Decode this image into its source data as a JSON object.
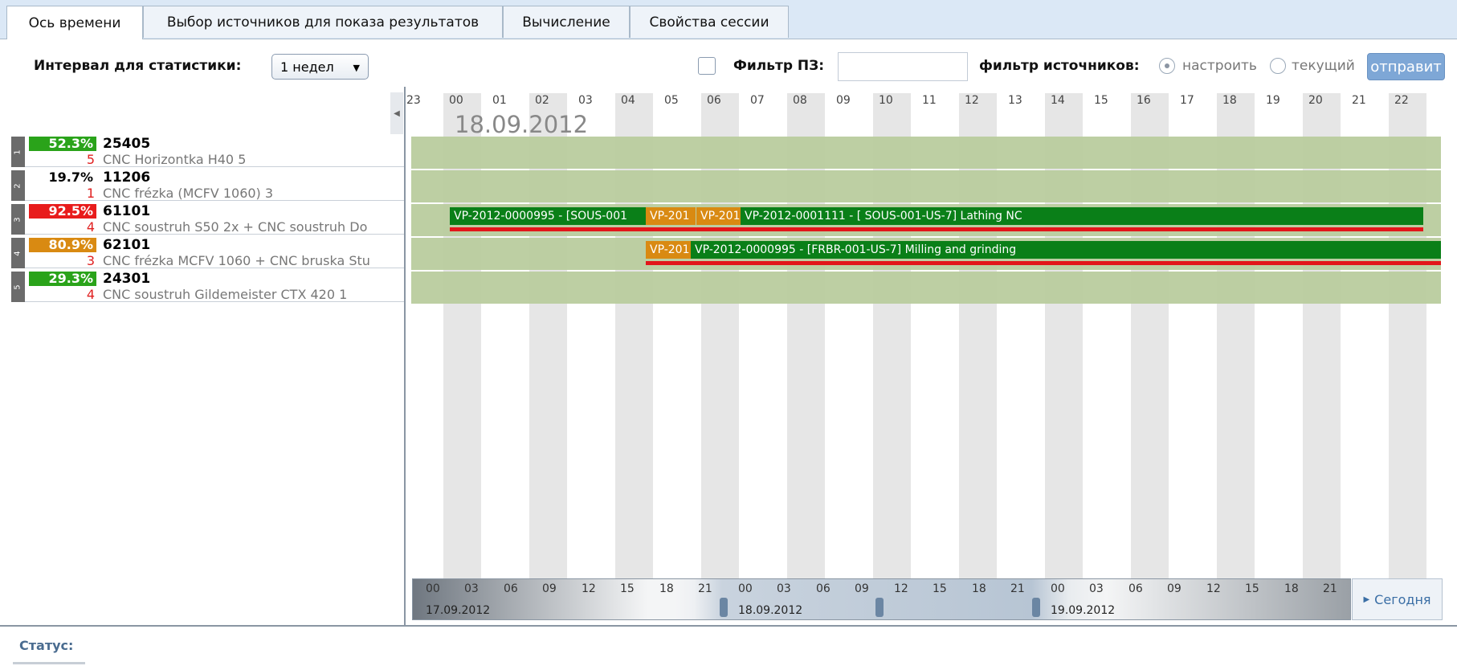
{
  "tabs": [
    {
      "label": "Ось времени",
      "active": true
    },
    {
      "label": "Выбор источников для показа результатов",
      "active": false
    },
    {
      "label": "Вычисление",
      "active": false
    },
    {
      "label": "Свойства сессии",
      "active": false
    }
  ],
  "toolbar": {
    "interval_label": "Интервал для статистики:",
    "interval_value": "1 недел",
    "filter_pz_label": "Фильтр ПЗ:",
    "filter_pz_value": "",
    "source_filter_label": "фильтр источников:",
    "radio_configure": "настроить",
    "radio_current": "текущий",
    "send_button": "отправит"
  },
  "timeline": {
    "date": "18.09.2012",
    "hours": [
      "23",
      "00",
      "01",
      "02",
      "03",
      "04",
      "05",
      "06",
      "07",
      "08",
      "09",
      "10",
      "11",
      "12",
      "13",
      "14",
      "15",
      "16",
      "17",
      "18",
      "19",
      "20",
      "21",
      "22"
    ]
  },
  "resources": [
    {
      "num": "1",
      "pct": "52.3%",
      "pct_color": "#2aa31a",
      "id": "25405",
      "count": "5",
      "name": "CNC Horizontka H40 5"
    },
    {
      "num": "2",
      "pct": "19.7%",
      "pct_color": "",
      "id": "11206",
      "count": "1",
      "name": "CNC frézka (MCFV 1060) 3"
    },
    {
      "num": "3",
      "pct": "92.5%",
      "pct_color": "#e81c1c",
      "id": "61101",
      "count": "4",
      "name": "CNC soustruh S50 2x + CNC soustruh Do"
    },
    {
      "num": "4",
      "pct": "80.9%",
      "pct_color": "#d98a12",
      "id": "62101",
      "count": "3",
      "name": "CNC frézka MCFV 1060 + CNC bruska Stu"
    },
    {
      "num": "5",
      "pct": "29.3%",
      "pct_color": "#2aa31a",
      "id": "24301",
      "count": "4",
      "name": "CNC soustruh Gildemeister CTX 420 1"
    }
  ],
  "bars": {
    "r3_a": "VP-2012-0000995 - [SOUS-001",
    "r3_b": "VP-201",
    "r3_c": "VP-201",
    "r3_d": "VP-2012-0001111 - [ SOUS-001-US-7] Lathing NC",
    "r4_a": "VP-201",
    "r4_b": "VP-2012-0000995 - [FRBR-001-US-7] Milling and grinding"
  },
  "slider": {
    "hours": [
      "00",
      "03",
      "06",
      "09",
      "12",
      "15",
      "18",
      "21"
    ],
    "dates": [
      "17.09.2012",
      "18.09.2012",
      "19.09.2012"
    ],
    "today_button": "Сегодня"
  },
  "status": {
    "label": "Статус:"
  },
  "colors": {
    "bar_green": "#0a7f18",
    "bar_orange": "#d98a12",
    "lane": "#b9cc9e",
    "late_line": "#e2161a"
  }
}
